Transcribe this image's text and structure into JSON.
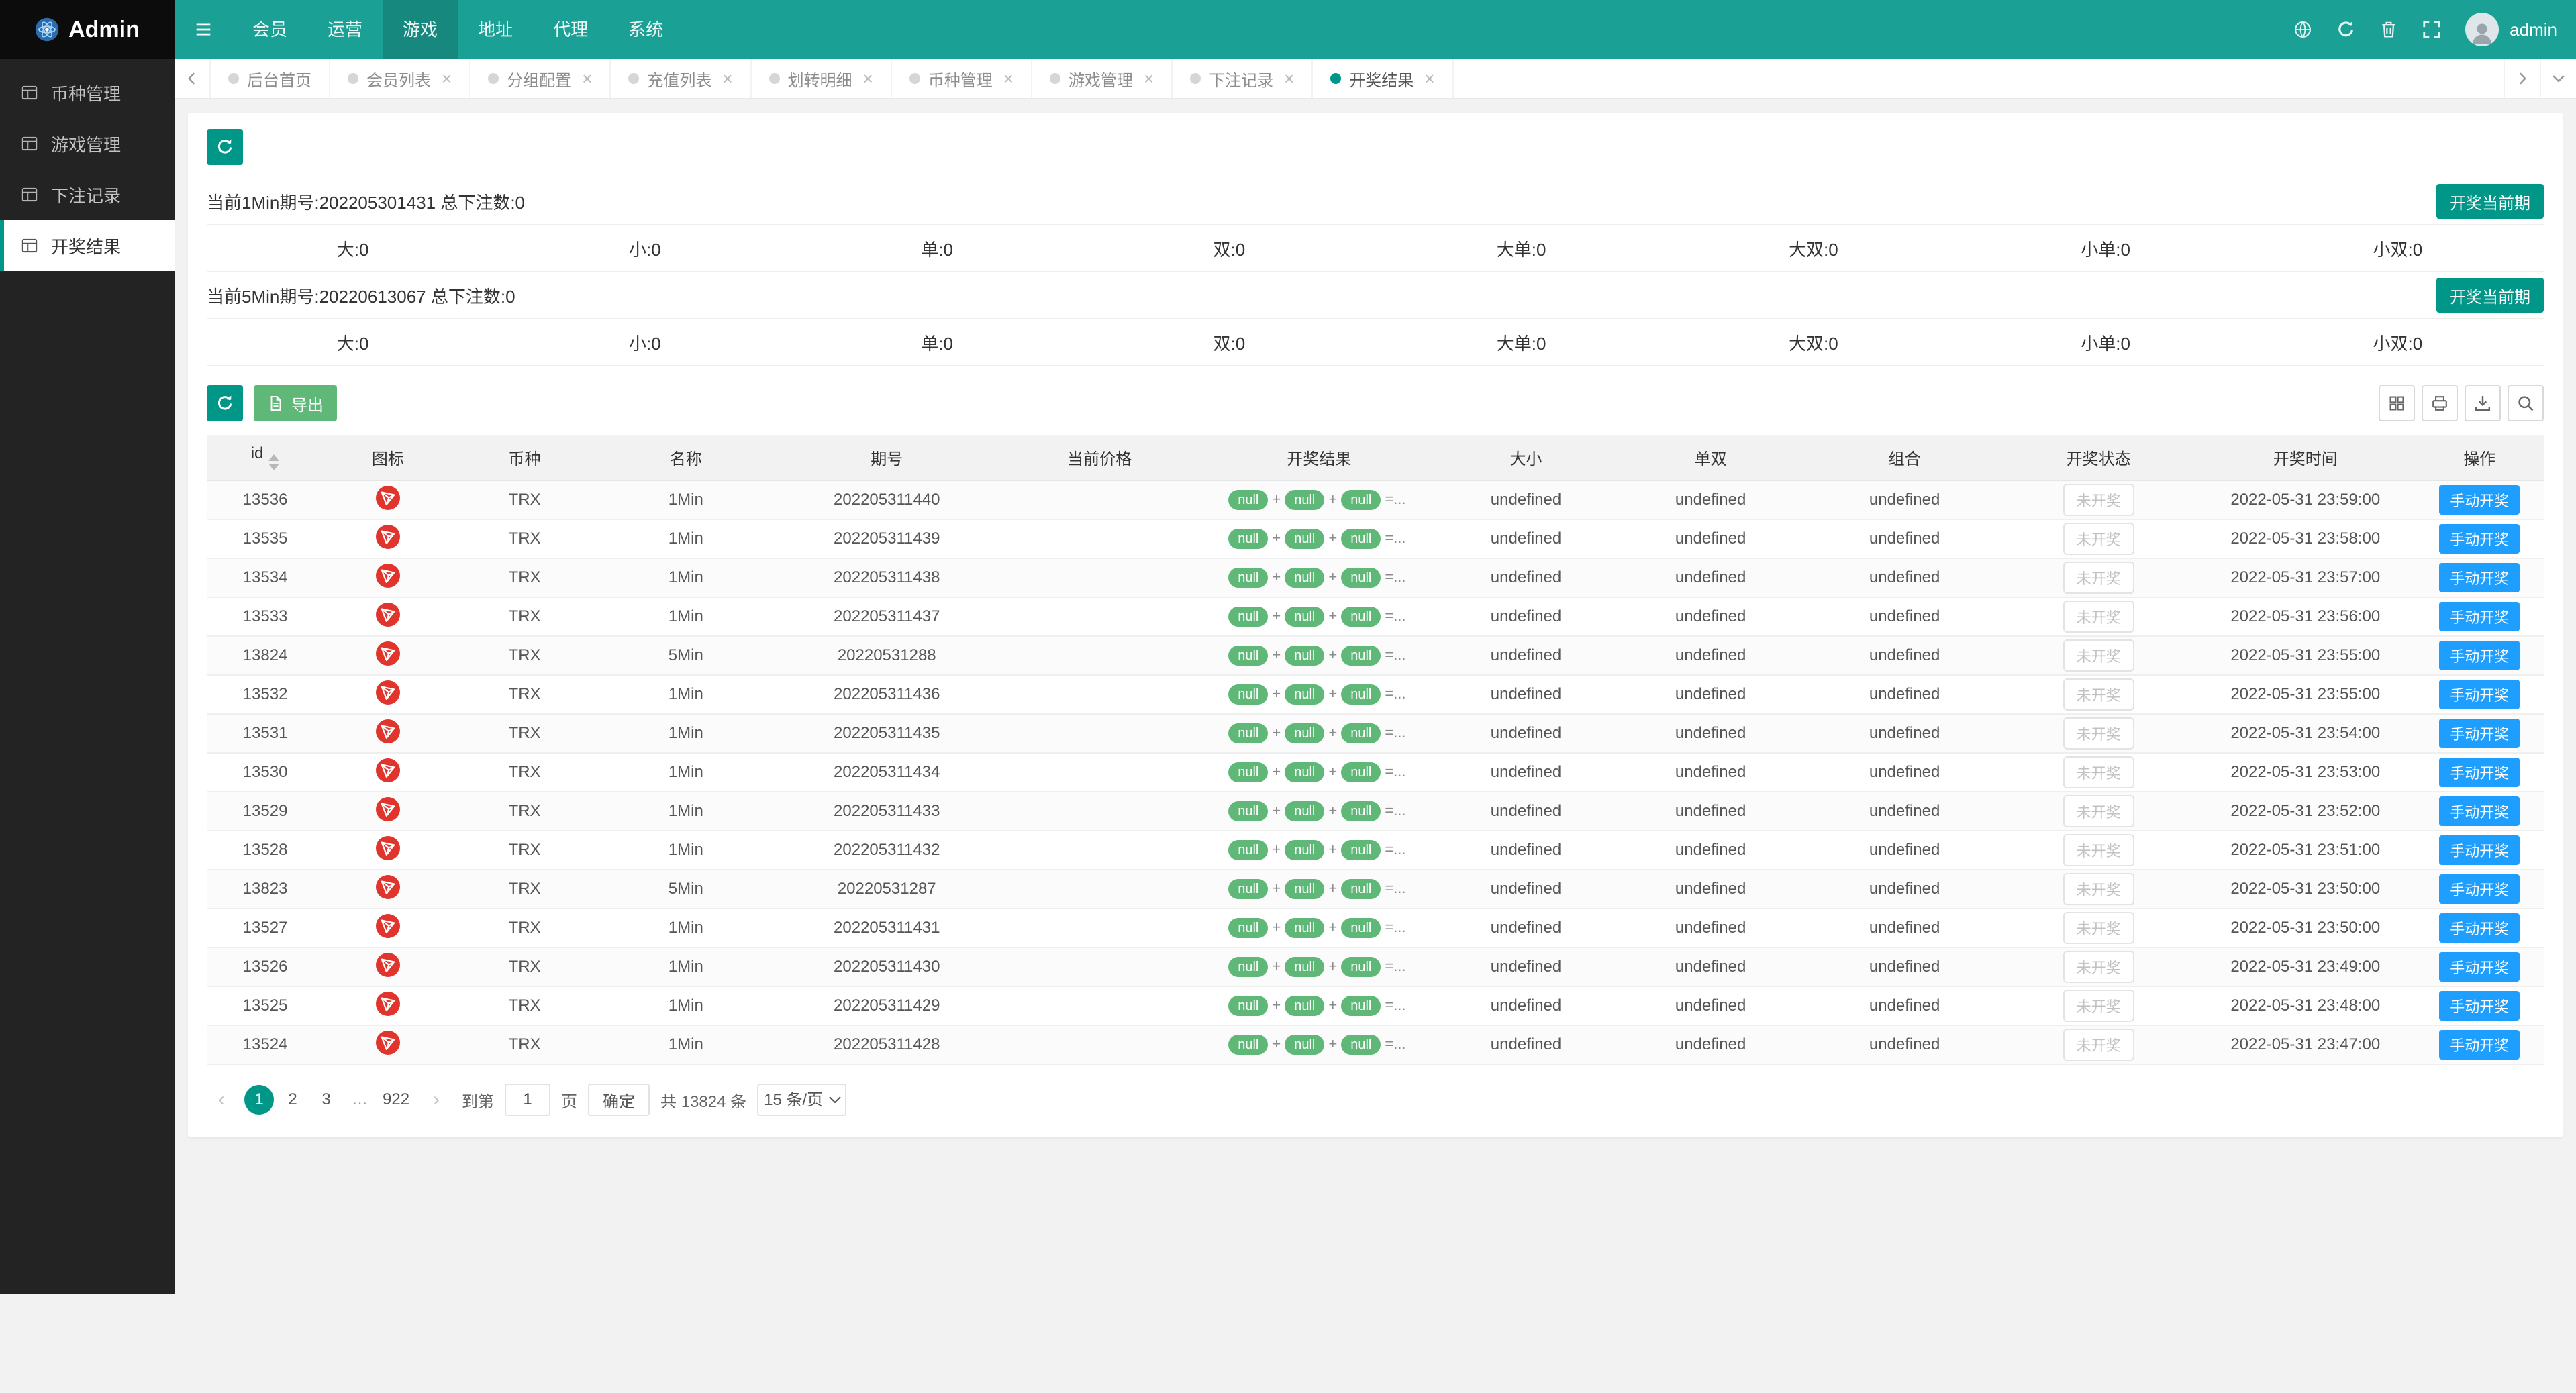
{
  "colors": {
    "accent": "#1aa094",
    "teal": "#009688",
    "green": "#5fb878",
    "blue": "#1e9fff",
    "red": "#e0342c",
    "sidebar_bg": "#232323",
    "logo_bg": "#0c0c0c"
  },
  "ui": {
    "close_glyph": "×"
  },
  "icons": {
    "logo-icon": "atom",
    "collapse-menu-icon": "hamburger",
    "globe-icon": "globe",
    "refresh-icon": "circular-arrow",
    "trash-icon": "trash-can",
    "fullscreen-icon": "expand-corners",
    "avatar": "user-silhouette",
    "menu-list-icon": "table-list",
    "tab-scroll-left-icon": "chevron-left",
    "tab-scroll-right-icon": "chevron-right",
    "tab-menu-icon": "chevron-down",
    "export-icon": "document",
    "columns-icon": "grid",
    "print-icon": "printer",
    "download-icon": "download-tray",
    "search-icon": "magnifier",
    "sort-icons": "caret-up-down",
    "trx-icon": "tron-logo-red-circle",
    "close-icon": "×"
  },
  "header": {
    "brand": "Admin",
    "nav": [
      {
        "label": "会员"
      },
      {
        "label": "运营"
      },
      {
        "label": "游戏",
        "active": true
      },
      {
        "label": "地址"
      },
      {
        "label": "代理"
      },
      {
        "label": "系统"
      }
    ],
    "username": "admin"
  },
  "sidebar": {
    "items": [
      {
        "label": "币种管理"
      },
      {
        "label": "游戏管理"
      },
      {
        "label": "下注记录"
      },
      {
        "label": "开奖结果",
        "active": true
      }
    ]
  },
  "tabs": [
    {
      "label": "后台首页",
      "closable": false
    },
    {
      "label": "会员列表",
      "closable": true
    },
    {
      "label": "分组配置",
      "closable": true
    },
    {
      "label": "充值列表",
      "closable": true
    },
    {
      "label": "划转明细",
      "closable": true
    },
    {
      "label": "币种管理",
      "closable": true
    },
    {
      "label": "游戏管理",
      "closable": true
    },
    {
      "label": "下注记录",
      "closable": true
    },
    {
      "label": "开奖结果",
      "closable": true,
      "active": true
    }
  ],
  "panels": [
    {
      "title": "当前1Min期号:202205301431 总下注数:0",
      "draw_button": "开奖当前期",
      "stats": [
        "大:0",
        "小:0",
        "单:0",
        "双:0",
        "大单:0",
        "大双:0",
        "小单:0",
        "小双:0"
      ]
    },
    {
      "title": "当前5Min期号:20220613067 总下注数:0",
      "draw_button": "开奖当前期",
      "stats": [
        "大:0",
        "小:0",
        "单:0",
        "双:0",
        "大单:0",
        "大双:0",
        "小单:0",
        "小双:0"
      ]
    }
  ],
  "toolbar": {
    "export_label": "导出"
  },
  "table": {
    "headers": [
      "id",
      "图标",
      "币种",
      "名称",
      "期号",
      "当前价格",
      "开奖结果",
      "大小",
      "单双",
      "组合",
      "开奖状态",
      "开奖时间",
      "操作"
    ],
    "null_label": "null",
    "plus": "+",
    "result_suffix": "=...",
    "rows": [
      {
        "id": "13536",
        "coin": "TRX",
        "name": "1Min",
        "issue": "202205311440",
        "price": "",
        "size": "undefined",
        "parity": "undefined",
        "combo": "undefined",
        "status": "未开奖",
        "time": "2022-05-31 23:59:00",
        "action": "手动开奖"
      },
      {
        "id": "13535",
        "coin": "TRX",
        "name": "1Min",
        "issue": "202205311439",
        "price": "",
        "size": "undefined",
        "parity": "undefined",
        "combo": "undefined",
        "status": "未开奖",
        "time": "2022-05-31 23:58:00",
        "action": "手动开奖"
      },
      {
        "id": "13534",
        "coin": "TRX",
        "name": "1Min",
        "issue": "202205311438",
        "price": "",
        "size": "undefined",
        "parity": "undefined",
        "combo": "undefined",
        "status": "未开奖",
        "time": "2022-05-31 23:57:00",
        "action": "手动开奖"
      },
      {
        "id": "13533",
        "coin": "TRX",
        "name": "1Min",
        "issue": "202205311437",
        "price": "",
        "size": "undefined",
        "parity": "undefined",
        "combo": "undefined",
        "status": "未开奖",
        "time": "2022-05-31 23:56:00",
        "action": "手动开奖"
      },
      {
        "id": "13824",
        "coin": "TRX",
        "name": "5Min",
        "issue": "20220531288",
        "price": "",
        "size": "undefined",
        "parity": "undefined",
        "combo": "undefined",
        "status": "未开奖",
        "time": "2022-05-31 23:55:00",
        "action": "手动开奖"
      },
      {
        "id": "13532",
        "coin": "TRX",
        "name": "1Min",
        "issue": "202205311436",
        "price": "",
        "size": "undefined",
        "parity": "undefined",
        "combo": "undefined",
        "status": "未开奖",
        "time": "2022-05-31 23:55:00",
        "action": "手动开奖"
      },
      {
        "id": "13531",
        "coin": "TRX",
        "name": "1Min",
        "issue": "202205311435",
        "price": "",
        "size": "undefined",
        "parity": "undefined",
        "combo": "undefined",
        "status": "未开奖",
        "time": "2022-05-31 23:54:00",
        "action": "手动开奖"
      },
      {
        "id": "13530",
        "coin": "TRX",
        "name": "1Min",
        "issue": "202205311434",
        "price": "",
        "size": "undefined",
        "parity": "undefined",
        "combo": "undefined",
        "status": "未开奖",
        "time": "2022-05-31 23:53:00",
        "action": "手动开奖"
      },
      {
        "id": "13529",
        "coin": "TRX",
        "name": "1Min",
        "issue": "202205311433",
        "price": "",
        "size": "undefined",
        "parity": "undefined",
        "combo": "undefined",
        "status": "未开奖",
        "time": "2022-05-31 23:52:00",
        "action": "手动开奖"
      },
      {
        "id": "13528",
        "coin": "TRX",
        "name": "1Min",
        "issue": "202205311432",
        "price": "",
        "size": "undefined",
        "parity": "undefined",
        "combo": "undefined",
        "status": "未开奖",
        "time": "2022-05-31 23:51:00",
        "action": "手动开奖"
      },
      {
        "id": "13823",
        "coin": "TRX",
        "name": "5Min",
        "issue": "20220531287",
        "price": "",
        "size": "undefined",
        "parity": "undefined",
        "combo": "undefined",
        "status": "未开奖",
        "time": "2022-05-31 23:50:00",
        "action": "手动开奖"
      },
      {
        "id": "13527",
        "coin": "TRX",
        "name": "1Min",
        "issue": "202205311431",
        "price": "",
        "size": "undefined",
        "parity": "undefined",
        "combo": "undefined",
        "status": "未开奖",
        "time": "2022-05-31 23:50:00",
        "action": "手动开奖"
      },
      {
        "id": "13526",
        "coin": "TRX",
        "name": "1Min",
        "issue": "202205311430",
        "price": "",
        "size": "undefined",
        "parity": "undefined",
        "combo": "undefined",
        "status": "未开奖",
        "time": "2022-05-31 23:49:00",
        "action": "手动开奖"
      },
      {
        "id": "13525",
        "coin": "TRX",
        "name": "1Min",
        "issue": "202205311429",
        "price": "",
        "size": "undefined",
        "parity": "undefined",
        "combo": "undefined",
        "status": "未开奖",
        "time": "2022-05-31 23:48:00",
        "action": "手动开奖"
      },
      {
        "id": "13524",
        "coin": "TRX",
        "name": "1Min",
        "issue": "202205311428",
        "price": "",
        "size": "undefined",
        "parity": "undefined",
        "combo": "undefined",
        "status": "未开奖",
        "time": "2022-05-31 23:47:00",
        "action": "手动开奖"
      }
    ]
  },
  "pagination": {
    "prev": "‹",
    "next": "›",
    "pages": [
      {
        "label": "1",
        "active": true
      },
      {
        "label": "2"
      },
      {
        "label": "3"
      },
      {
        "label": "…",
        "ellipsis": true
      },
      {
        "label": "922"
      }
    ],
    "goto_label": "到第",
    "goto_value": "1",
    "page_unit": "页",
    "confirm": "确定",
    "total": "共 13824 条",
    "per_page": "15 条/页"
  }
}
